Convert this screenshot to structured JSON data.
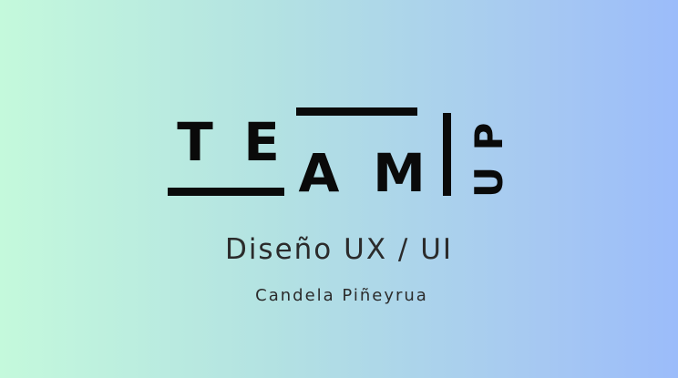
{
  "logo": {
    "text": "TEAMUP",
    "letters": [
      "T",
      "E",
      "A",
      "M",
      "U",
      "P"
    ]
  },
  "subtitle": "Diseño UX / UI",
  "author": "Candela Piñeyrua",
  "colors": {
    "gradient_start": "#c4f9dc",
    "gradient_end": "#9bbcfa",
    "ink": "#0a0a0a",
    "text": "#2b2b2b"
  }
}
